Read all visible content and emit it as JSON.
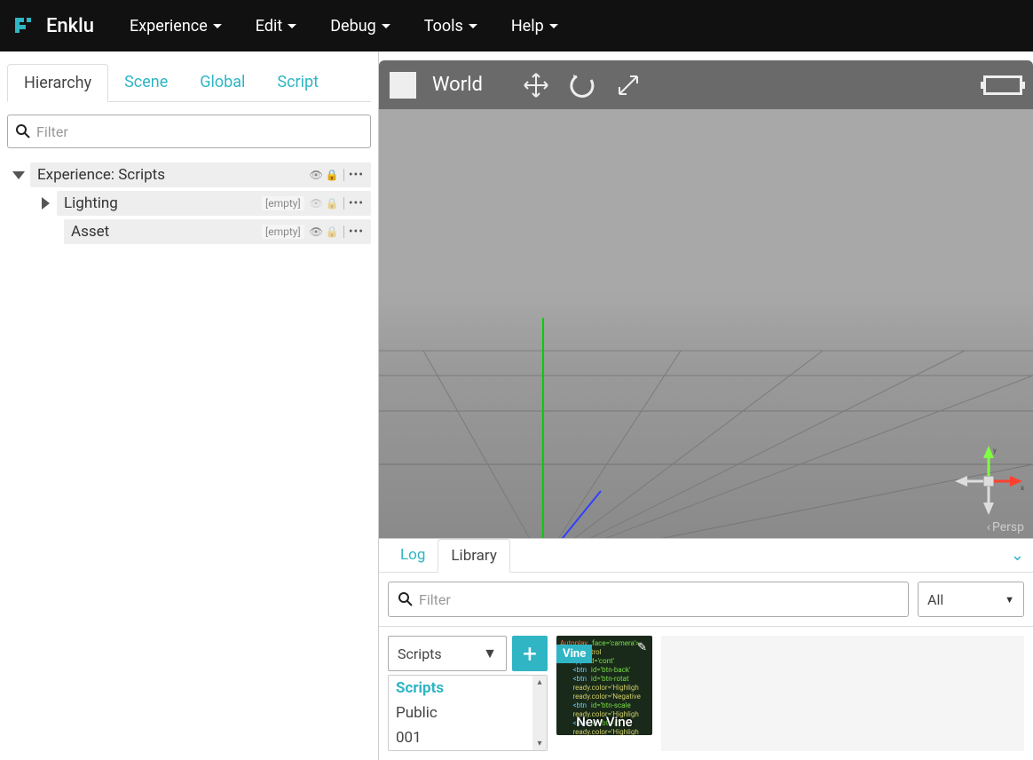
{
  "brand": "Enklu",
  "menu": [
    "Experience",
    "Edit",
    "Debug",
    "Tools",
    "Help"
  ],
  "left_tabs": [
    "Hierarchy",
    "Scene",
    "Global",
    "Script"
  ],
  "left_active_tab": 0,
  "filter_placeholder": "Filter",
  "hierarchy": {
    "root": {
      "label": "Experience: Scripts"
    },
    "children": [
      {
        "label": "Lighting",
        "empty_tag": "[empty]"
      },
      {
        "label": "Asset",
        "empty_tag": "[empty]"
      }
    ]
  },
  "viewport": {
    "mode_label": "World",
    "persp_label": "Persp",
    "gizmo_axes": {
      "x": "x",
      "y": "y"
    }
  },
  "bottom_tabs": [
    "Log",
    "Library"
  ],
  "bottom_active_tab": 1,
  "library": {
    "filter_placeholder": "Filter",
    "all_label": "All",
    "category_select": "Scripts",
    "categories": [
      "Scripts",
      "Public",
      "001"
    ],
    "add_label": "+",
    "thumb": {
      "tag": "Vine",
      "title": "New Vine"
    }
  }
}
